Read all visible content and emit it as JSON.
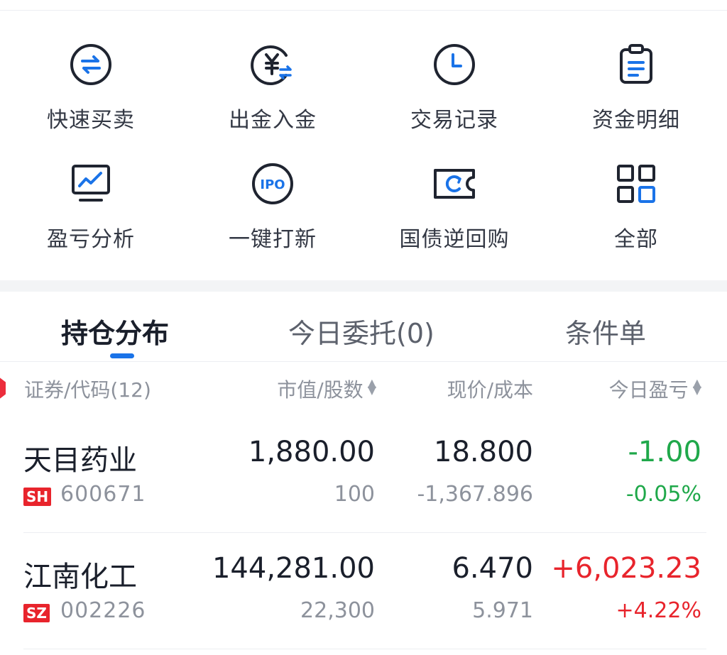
{
  "actions": [
    {
      "label": "快速买卖",
      "icon": "swap-arrows-icon"
    },
    {
      "label": "出金入金",
      "icon": "yuan-transfer-icon"
    },
    {
      "label": "交易记录",
      "icon": "clock-icon"
    },
    {
      "label": "资金明细",
      "icon": "clipboard-icon"
    },
    {
      "label": "盈亏分析",
      "icon": "line-chart-monitor-icon"
    },
    {
      "label": "一键打新",
      "icon": "ipo-icon"
    },
    {
      "label": "国债逆回购",
      "icon": "ticket-refresh-icon"
    },
    {
      "label": "全部",
      "icon": "grid-apps-icon"
    }
  ],
  "tabs": [
    {
      "label": "持仓分布",
      "active": true
    },
    {
      "label": "今日委托(0)",
      "active": false
    },
    {
      "label": "条件单",
      "active": false
    }
  ],
  "columns": {
    "security": "证券/代码(12)",
    "market_value": "市值/股数",
    "price": "现价/成本",
    "today_pnl": "今日盈亏"
  },
  "holdings": [
    {
      "name": "天目药业",
      "market": "SH",
      "code": "600671",
      "market_value": "1,880.00",
      "shares": "100",
      "price": "18.800",
      "cost": "-1,367.896",
      "pnl": "-1.00",
      "pnl_pct": "-0.05%",
      "direction": "down"
    },
    {
      "name": "江南化工",
      "market": "SZ",
      "code": "002226",
      "market_value": "144,281.00",
      "shares": "22,300",
      "price": "6.470",
      "cost": "5.971",
      "pnl": "+6,023.23",
      "pnl_pct": "+4.22%",
      "direction": "up"
    }
  ],
  "colors": {
    "accent": "#1a73e8",
    "up": "#e8242c",
    "down": "#1fa84a",
    "text": "#1a1f2b",
    "muted": "#8d929c"
  }
}
